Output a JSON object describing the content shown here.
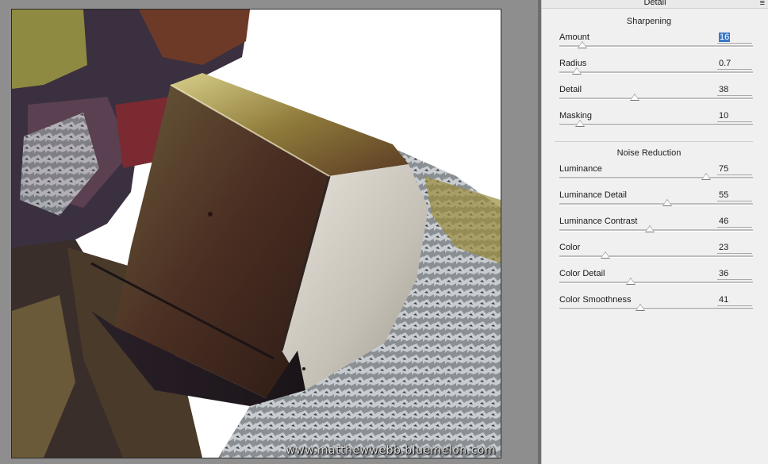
{
  "panel": {
    "title": "Detail",
    "menu_icon": "panel-menu-icon"
  },
  "sharpening": {
    "title": "Sharpening",
    "sliders": [
      {
        "label": "Amount",
        "value": "16",
        "fraction": 0.11,
        "active": true
      },
      {
        "label": "Radius",
        "value": "0.7",
        "fraction": 0.08
      },
      {
        "label": "Detail",
        "value": "38",
        "fraction": 0.38
      },
      {
        "label": "Masking",
        "value": "10",
        "fraction": 0.1
      }
    ]
  },
  "noise_reduction": {
    "title": "Noise Reduction",
    "sliders": [
      {
        "label": "Luminance",
        "value": "75",
        "fraction": 0.75
      },
      {
        "label": "Luminance Detail",
        "value": "55",
        "fraction": 0.55
      },
      {
        "label": "Luminance Contrast",
        "value": "46",
        "fraction": 0.46
      },
      {
        "label": "Color",
        "value": "23",
        "fraction": 0.23
      },
      {
        "label": "Color Detail",
        "value": "36",
        "fraction": 0.36
      },
      {
        "label": "Color Smoothness",
        "value": "41",
        "fraction": 0.41
      }
    ]
  },
  "preview": {
    "watermark": "www.matthewwebb.bluemelon.com"
  }
}
